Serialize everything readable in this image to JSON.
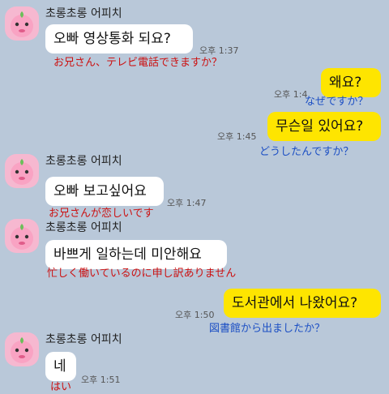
{
  "sender_name": "초롱초롱 어피치",
  "messages": [
    {
      "text": "오빠 영상통화 되요?",
      "time": "오후 1:37",
      "translation": "お兄さん、テレビ電話できますか？"
    },
    {
      "text": "왜요?",
      "time": "오후 1:4",
      "translation": "なぜですか？"
    },
    {
      "text": "무슨일 있어요?",
      "time": "오후 1:45",
      "translation": "どうしたんですか？"
    },
    {
      "text": "오빠 보고싶어요",
      "time": "오후 1:47",
      "translation": "お兄さんが恋しいです"
    },
    {
      "text": "바쁘게 일하는데 미안해요",
      "time": "",
      "translation": "忙しく働いているのに申し訳ありません"
    },
    {
      "text": "도서관에서 나왔어요?",
      "time": "오후 1:50",
      "translation": "図書館から出ましたか？"
    },
    {
      "text": "네",
      "time": "오후 1:51",
      "translation": "はい"
    }
  ],
  "colors": {
    "background": "#b9c8d9",
    "incoming": "#ffffff",
    "outgoing": "#fee500",
    "translation_red": "#cc1111",
    "translation_blue": "#1c4fc4"
  },
  "icons": {
    "avatar": "apeach-avatar-icon"
  }
}
